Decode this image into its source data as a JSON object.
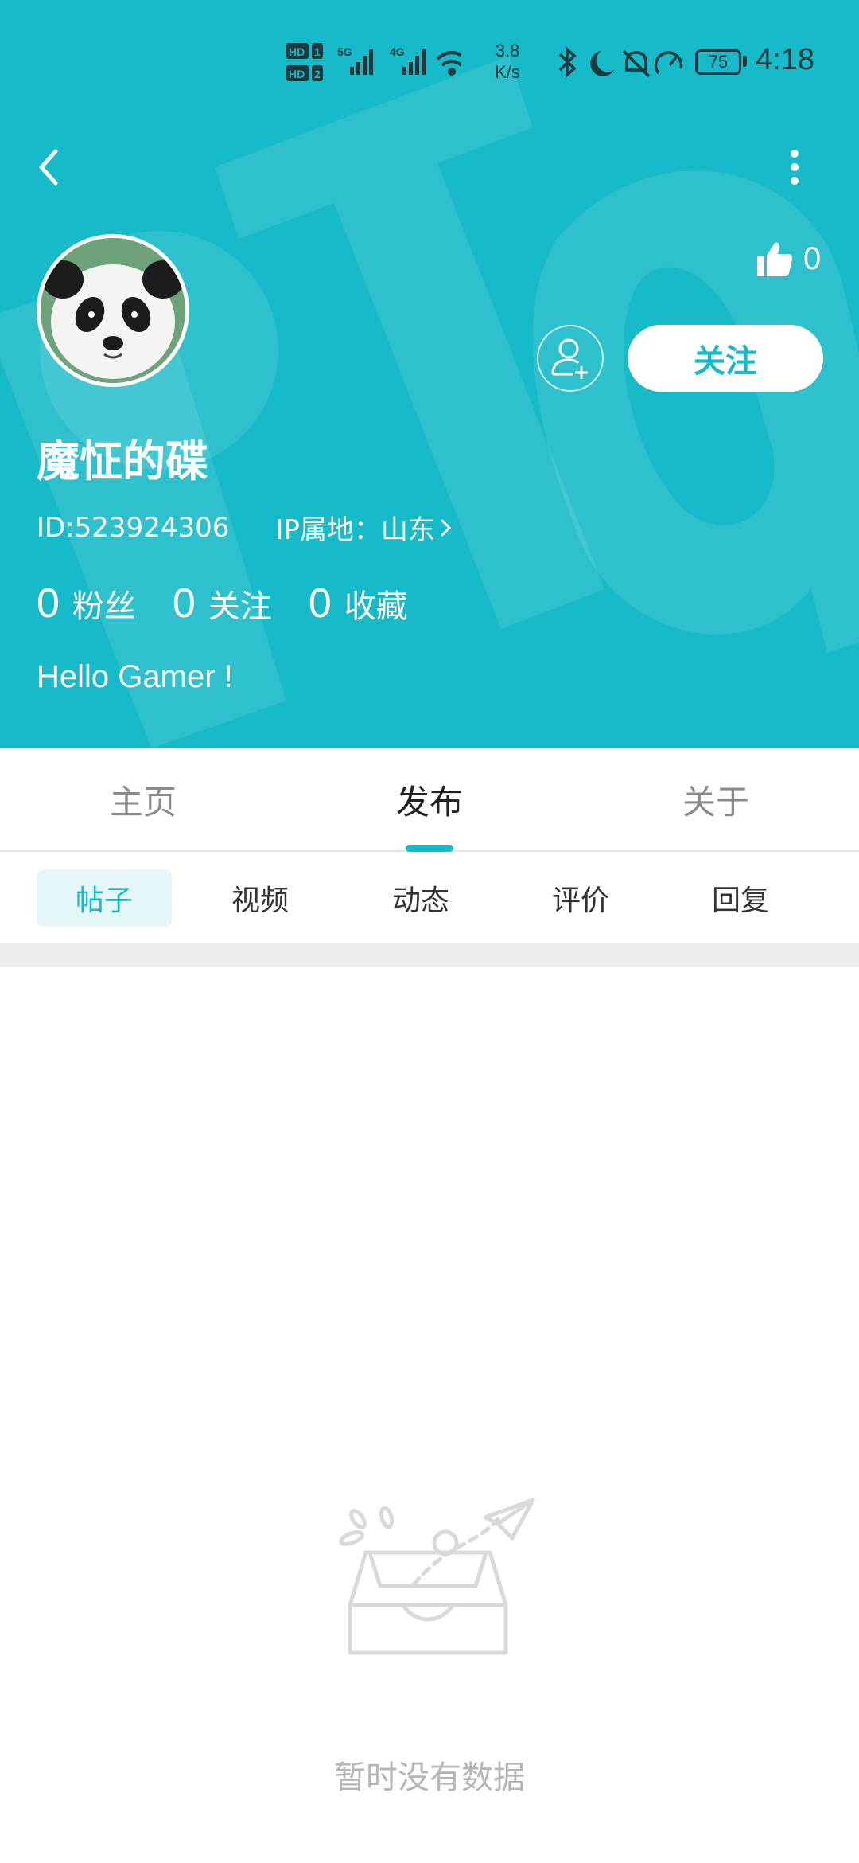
{
  "status_bar": {
    "network_speed_value": "3.8",
    "network_speed_unit": "K/s",
    "battery": "75",
    "time": "4:18"
  },
  "header": {
    "background_color": "#17BAC8",
    "likes_count": "0",
    "follow_label": "关注"
  },
  "profile": {
    "username": "魔怔的碟",
    "id_text": "ID:523924306",
    "ip_text": "IP属地：山东",
    "stats": [
      {
        "value": "0",
        "label": "粉丝"
      },
      {
        "value": "0",
        "label": "关注"
      },
      {
        "value": "0",
        "label": "收藏"
      }
    ],
    "bio": "Hello Gamer !"
  },
  "tabs": [
    {
      "label": "主页",
      "active": false
    },
    {
      "label": "发布",
      "active": true
    },
    {
      "label": "关于",
      "active": false
    }
  ],
  "subtabs": [
    {
      "label": "帖子",
      "active": true
    },
    {
      "label": "视频",
      "active": false
    },
    {
      "label": "动态",
      "active": false
    },
    {
      "label": "评价",
      "active": false
    },
    {
      "label": "回复",
      "active": false
    }
  ],
  "empty_state": {
    "icon": "empty-inbox-paper-plane-icon",
    "text": "暂时没有数据"
  }
}
